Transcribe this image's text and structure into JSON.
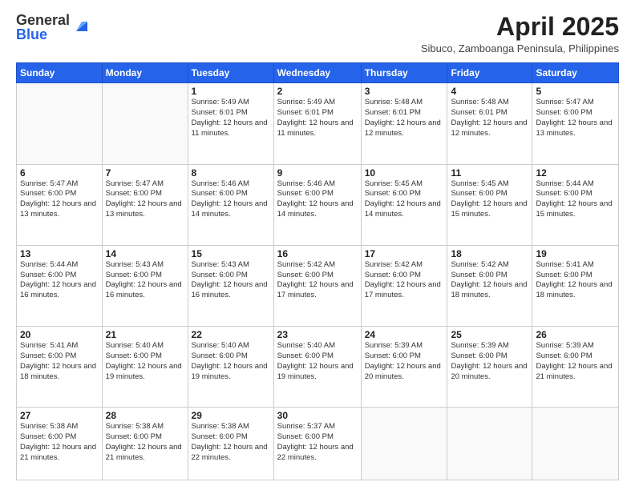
{
  "logo": {
    "general": "General",
    "blue": "Blue"
  },
  "header": {
    "month": "April 2025",
    "location": "Sibuco, Zamboanga Peninsula, Philippines"
  },
  "weekdays": [
    "Sunday",
    "Monday",
    "Tuesday",
    "Wednesday",
    "Thursday",
    "Friday",
    "Saturday"
  ],
  "rows": [
    [
      {
        "day": "",
        "info": ""
      },
      {
        "day": "",
        "info": ""
      },
      {
        "day": "1",
        "info": "Sunrise: 5:49 AM\nSunset: 6:01 PM\nDaylight: 12 hours and 11 minutes."
      },
      {
        "day": "2",
        "info": "Sunrise: 5:49 AM\nSunset: 6:01 PM\nDaylight: 12 hours and 11 minutes."
      },
      {
        "day": "3",
        "info": "Sunrise: 5:48 AM\nSunset: 6:01 PM\nDaylight: 12 hours and 12 minutes."
      },
      {
        "day": "4",
        "info": "Sunrise: 5:48 AM\nSunset: 6:01 PM\nDaylight: 12 hours and 12 minutes."
      },
      {
        "day": "5",
        "info": "Sunrise: 5:47 AM\nSunset: 6:00 PM\nDaylight: 12 hours and 13 minutes."
      }
    ],
    [
      {
        "day": "6",
        "info": "Sunrise: 5:47 AM\nSunset: 6:00 PM\nDaylight: 12 hours and 13 minutes."
      },
      {
        "day": "7",
        "info": "Sunrise: 5:47 AM\nSunset: 6:00 PM\nDaylight: 12 hours and 13 minutes."
      },
      {
        "day": "8",
        "info": "Sunrise: 5:46 AM\nSunset: 6:00 PM\nDaylight: 12 hours and 14 minutes."
      },
      {
        "day": "9",
        "info": "Sunrise: 5:46 AM\nSunset: 6:00 PM\nDaylight: 12 hours and 14 minutes."
      },
      {
        "day": "10",
        "info": "Sunrise: 5:45 AM\nSunset: 6:00 PM\nDaylight: 12 hours and 14 minutes."
      },
      {
        "day": "11",
        "info": "Sunrise: 5:45 AM\nSunset: 6:00 PM\nDaylight: 12 hours and 15 minutes."
      },
      {
        "day": "12",
        "info": "Sunrise: 5:44 AM\nSunset: 6:00 PM\nDaylight: 12 hours and 15 minutes."
      }
    ],
    [
      {
        "day": "13",
        "info": "Sunrise: 5:44 AM\nSunset: 6:00 PM\nDaylight: 12 hours and 16 minutes."
      },
      {
        "day": "14",
        "info": "Sunrise: 5:43 AM\nSunset: 6:00 PM\nDaylight: 12 hours and 16 minutes."
      },
      {
        "day": "15",
        "info": "Sunrise: 5:43 AM\nSunset: 6:00 PM\nDaylight: 12 hours and 16 minutes."
      },
      {
        "day": "16",
        "info": "Sunrise: 5:42 AM\nSunset: 6:00 PM\nDaylight: 12 hours and 17 minutes."
      },
      {
        "day": "17",
        "info": "Sunrise: 5:42 AM\nSunset: 6:00 PM\nDaylight: 12 hours and 17 minutes."
      },
      {
        "day": "18",
        "info": "Sunrise: 5:42 AM\nSunset: 6:00 PM\nDaylight: 12 hours and 18 minutes."
      },
      {
        "day": "19",
        "info": "Sunrise: 5:41 AM\nSunset: 6:00 PM\nDaylight: 12 hours and 18 minutes."
      }
    ],
    [
      {
        "day": "20",
        "info": "Sunrise: 5:41 AM\nSunset: 6:00 PM\nDaylight: 12 hours and 18 minutes."
      },
      {
        "day": "21",
        "info": "Sunrise: 5:40 AM\nSunset: 6:00 PM\nDaylight: 12 hours and 19 minutes."
      },
      {
        "day": "22",
        "info": "Sunrise: 5:40 AM\nSunset: 6:00 PM\nDaylight: 12 hours and 19 minutes."
      },
      {
        "day": "23",
        "info": "Sunrise: 5:40 AM\nSunset: 6:00 PM\nDaylight: 12 hours and 19 minutes."
      },
      {
        "day": "24",
        "info": "Sunrise: 5:39 AM\nSunset: 6:00 PM\nDaylight: 12 hours and 20 minutes."
      },
      {
        "day": "25",
        "info": "Sunrise: 5:39 AM\nSunset: 6:00 PM\nDaylight: 12 hours and 20 minutes."
      },
      {
        "day": "26",
        "info": "Sunrise: 5:39 AM\nSunset: 6:00 PM\nDaylight: 12 hours and 21 minutes."
      }
    ],
    [
      {
        "day": "27",
        "info": "Sunrise: 5:38 AM\nSunset: 6:00 PM\nDaylight: 12 hours and 21 minutes."
      },
      {
        "day": "28",
        "info": "Sunrise: 5:38 AM\nSunset: 6:00 PM\nDaylight: 12 hours and 21 minutes."
      },
      {
        "day": "29",
        "info": "Sunrise: 5:38 AM\nSunset: 6:00 PM\nDaylight: 12 hours and 22 minutes."
      },
      {
        "day": "30",
        "info": "Sunrise: 5:37 AM\nSunset: 6:00 PM\nDaylight: 12 hours and 22 minutes."
      },
      {
        "day": "",
        "info": ""
      },
      {
        "day": "",
        "info": ""
      },
      {
        "day": "",
        "info": ""
      }
    ]
  ]
}
